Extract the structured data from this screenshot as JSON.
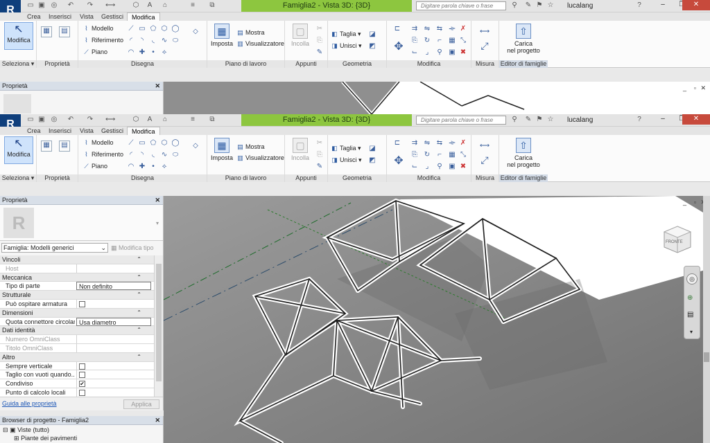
{
  "app": {
    "logo": "R",
    "title": "Famiglia2 - Vista 3D: {3D}",
    "search_placeholder": "Digitare parola chiave o frase",
    "user": "lucalang",
    "help": "?"
  },
  "tabs": [
    {
      "label": "Crea"
    },
    {
      "label": "Inserisci"
    },
    {
      "label": "Vista"
    },
    {
      "label": "Gestisci"
    },
    {
      "label": "Modifica"
    }
  ],
  "ribbon": {
    "modifica": "Modifica",
    "seleziona": "Seleziona ▾",
    "proprieta": "Proprietà",
    "disegna": "Disegna",
    "modello": "Modello",
    "riferimento": "Riferimento",
    "piano": "Piano",
    "imposta": "Imposta",
    "mostra": "Mostra",
    "visualizzatore": "Visualizzatore",
    "piano_di_lavoro": "Piano di lavoro",
    "incolla": "Incolla",
    "appunti": "Appunti",
    "taglia": "Taglia ▾",
    "unisci": "Unisci ▾",
    "geometria": "Geometria",
    "modifica_panel": "Modifica",
    "misura": "Misura",
    "carica_line1": "Carica",
    "carica_line2": "nel progetto",
    "editor_famiglie": "Editor di famiglie"
  },
  "properties_panel": {
    "title": "Proprietà",
    "family_selector": "Famiglia: Modelli generici",
    "edit_type": "Modifica tipo",
    "rows": [
      {
        "label": "Vincoli",
        "group": true
      },
      {
        "label": "Host",
        "value": "",
        "dim": true
      },
      {
        "label": "Meccanica",
        "group": true
      },
      {
        "label": "Tipo di parte",
        "value": "Non definito"
      },
      {
        "label": "Strutturale",
        "group": true
      },
      {
        "label": "Può ospitare armatura",
        "check": ""
      },
      {
        "label": "Dimensioni",
        "group": true
      },
      {
        "label": "Quota connettore circolare",
        "value": "Usa diametro"
      },
      {
        "label": "Dati identità",
        "group": true
      },
      {
        "label": "Numero OmniClass",
        "value": "",
        "dim": true
      },
      {
        "label": "Titolo OmniClass",
        "value": "",
        "dim": true
      },
      {
        "label": "Altro",
        "group": true
      },
      {
        "label": "Sempre verticale",
        "check": ""
      },
      {
        "label": "Taglio con vuoti quando...",
        "check": ""
      },
      {
        "label": "Condiviso",
        "check": "✔"
      },
      {
        "label": "Punto di calcolo locali",
        "check": ""
      }
    ],
    "help_link": "Guida alle proprietà",
    "apply": "Applica"
  },
  "project_browser": {
    "title": "Browser di progetto - Famiglia2",
    "root": "Viste (tutto)",
    "child": "Piante dei pavimenti"
  },
  "viewcube_label": "FRONTE"
}
